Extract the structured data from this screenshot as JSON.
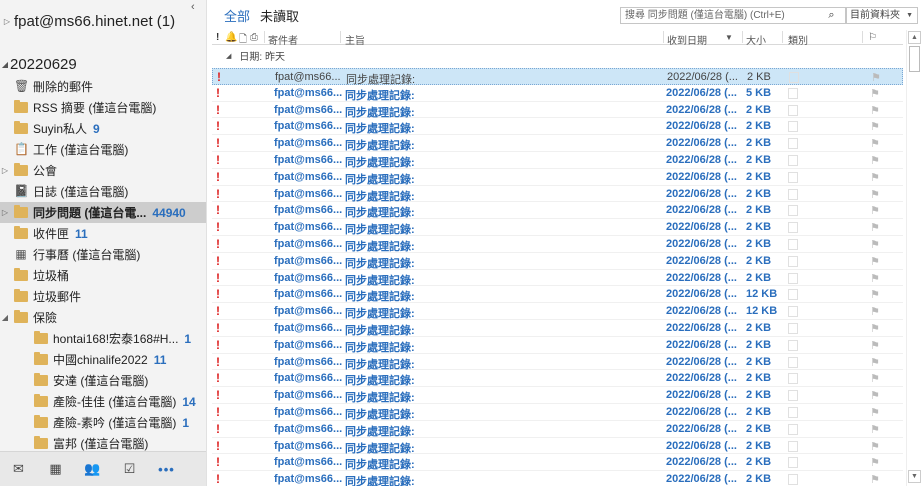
{
  "sidebar": {
    "account": "fpat@ms66.hinet.net (1)",
    "store": "20220629",
    "folders": [
      {
        "name": "刪除的郵件",
        "count": "",
        "icon": "trash-icon",
        "level": 1,
        "arrow": "",
        "selected": false
      },
      {
        "name": "RSS 摘要 (僅這台電腦)",
        "count": "",
        "icon": "folder-icon",
        "level": 1,
        "arrow": "",
        "selected": false
      },
      {
        "name": "Suyin私人",
        "count": "9",
        "icon": "folder-icon",
        "level": 1,
        "arrow": "",
        "selected": false
      },
      {
        "name": "工作 (僅這台電腦)",
        "count": "",
        "icon": "task-icon",
        "level": 1,
        "arrow": "",
        "selected": false
      },
      {
        "name": "公會",
        "count": "",
        "icon": "folder-icon",
        "level": 1,
        "arrow": "▷",
        "selected": false
      },
      {
        "name": "日誌 (僅這台電腦)",
        "count": "",
        "icon": "journal-icon",
        "level": 1,
        "arrow": "",
        "selected": false
      },
      {
        "name": "同步問題 (僅這台電...",
        "count": "44940",
        "icon": "folder-icon",
        "level": 1,
        "arrow": "▷",
        "selected": true
      },
      {
        "name": "收件匣",
        "count": "11",
        "icon": "folder-icon",
        "level": 1,
        "arrow": "",
        "selected": false
      },
      {
        "name": "行事曆 (僅這台電腦)",
        "count": "",
        "icon": "calendar-icon",
        "level": 1,
        "arrow": "",
        "selected": false
      },
      {
        "name": "垃圾桶",
        "count": "",
        "icon": "folder-icon",
        "level": 1,
        "arrow": "",
        "selected": false
      },
      {
        "name": "垃圾郵件",
        "count": "",
        "icon": "folder-icon",
        "level": 1,
        "arrow": "",
        "selected": false
      },
      {
        "name": "保險",
        "count": "",
        "icon": "folder-icon",
        "level": 1,
        "arrow": "◢",
        "selected": false
      },
      {
        "name": "hontai168!宏泰168#H...",
        "count": "1",
        "icon": "folder-icon",
        "level": 2,
        "arrow": "",
        "selected": false
      },
      {
        "name": "中國chinalife2022",
        "count": "11",
        "icon": "folder-icon",
        "level": 2,
        "arrow": "",
        "selected": false
      },
      {
        "name": "安達 (僅這台電腦)",
        "count": "",
        "icon": "folder-icon",
        "level": 2,
        "arrow": "",
        "selected": false
      },
      {
        "name": "產險-佳佳 (僅這台電腦)",
        "count": "14",
        "icon": "folder-icon",
        "level": 2,
        "arrow": "",
        "selected": false
      },
      {
        "name": "產險-素吟 (僅這台電腦)",
        "count": "1",
        "icon": "folder-icon",
        "level": 2,
        "arrow": "",
        "selected": false
      },
      {
        "name": "富邦 (僅這台電腦)",
        "count": "",
        "icon": "folder-icon",
        "level": 2,
        "arrow": "",
        "selected": false
      }
    ],
    "nav": [
      "mail-icon",
      "calendar-icon",
      "people-icon",
      "tasks-icon",
      "more-icon"
    ]
  },
  "toolbar": {
    "filter_all": "全部",
    "filter_unread": "未讀取",
    "search_placeholder": "搜尋 同步問題 (僅這台電腦) (Ctrl+E)",
    "scope": "目前資料夾"
  },
  "columns": {
    "from": "寄件者",
    "subject": "主旨",
    "received": "收到日期",
    "size": "大小",
    "category": "類別"
  },
  "group_label": "日期: 昨天",
  "messages": [
    {
      "from": "fpat@ms66...",
      "subject": "同步處理記錄:",
      "received": "2022/06/28 (...",
      "size": "2 KB",
      "selected": true
    },
    {
      "from": "fpat@ms66...",
      "subject": "同步處理記錄:",
      "received": "2022/06/28 (...",
      "size": "5 KB",
      "selected": false
    },
    {
      "from": "fpat@ms66...",
      "subject": "同步處理記錄:",
      "received": "2022/06/28 (...",
      "size": "2 KB",
      "selected": false
    },
    {
      "from": "fpat@ms66...",
      "subject": "同步處理記錄:",
      "received": "2022/06/28 (...",
      "size": "2 KB",
      "selected": false
    },
    {
      "from": "fpat@ms66...",
      "subject": "同步處理記錄:",
      "received": "2022/06/28 (...",
      "size": "2 KB",
      "selected": false
    },
    {
      "from": "fpat@ms66...",
      "subject": "同步處理記錄:",
      "received": "2022/06/28 (...",
      "size": "2 KB",
      "selected": false
    },
    {
      "from": "fpat@ms66...",
      "subject": "同步處理記錄:",
      "received": "2022/06/28 (...",
      "size": "2 KB",
      "selected": false
    },
    {
      "from": "fpat@ms66...",
      "subject": "同步處理記錄:",
      "received": "2022/06/28 (...",
      "size": "2 KB",
      "selected": false
    },
    {
      "from": "fpat@ms66...",
      "subject": "同步處理記錄:",
      "received": "2022/06/28 (...",
      "size": "2 KB",
      "selected": false
    },
    {
      "from": "fpat@ms66...",
      "subject": "同步處理記錄:",
      "received": "2022/06/28 (...",
      "size": "2 KB",
      "selected": false
    },
    {
      "from": "fpat@ms66...",
      "subject": "同步處理記錄:",
      "received": "2022/06/28 (...",
      "size": "2 KB",
      "selected": false
    },
    {
      "from": "fpat@ms66...",
      "subject": "同步處理記錄:",
      "received": "2022/06/28 (...",
      "size": "2 KB",
      "selected": false
    },
    {
      "from": "fpat@ms66...",
      "subject": "同步處理記錄:",
      "received": "2022/06/28 (...",
      "size": "2 KB",
      "selected": false
    },
    {
      "from": "fpat@ms66...",
      "subject": "同步處理記錄:",
      "received": "2022/06/28 (...",
      "size": "12 KB",
      "selected": false
    },
    {
      "from": "fpat@ms66...",
      "subject": "同步處理記錄:",
      "received": "2022/06/28 (...",
      "size": "12 KB",
      "selected": false
    },
    {
      "from": "fpat@ms66...",
      "subject": "同步處理記錄:",
      "received": "2022/06/28 (...",
      "size": "2 KB",
      "selected": false
    },
    {
      "from": "fpat@ms66...",
      "subject": "同步處理記錄:",
      "received": "2022/06/28 (...",
      "size": "2 KB",
      "selected": false
    },
    {
      "from": "fpat@ms66...",
      "subject": "同步處理記錄:",
      "received": "2022/06/28 (...",
      "size": "2 KB",
      "selected": false
    },
    {
      "from": "fpat@ms66...",
      "subject": "同步處理記錄:",
      "received": "2022/06/28 (...",
      "size": "2 KB",
      "selected": false
    },
    {
      "from": "fpat@ms66...",
      "subject": "同步處理記錄:",
      "received": "2022/06/28 (...",
      "size": "2 KB",
      "selected": false
    },
    {
      "from": "fpat@ms66...",
      "subject": "同步處理記錄:",
      "received": "2022/06/28 (...",
      "size": "2 KB",
      "selected": false
    },
    {
      "from": "fpat@ms66...",
      "subject": "同步處理記錄:",
      "received": "2022/06/28 (...",
      "size": "2 KB",
      "selected": false
    },
    {
      "from": "fpat@ms66...",
      "subject": "同步處理記錄:",
      "received": "2022/06/28 (...",
      "size": "2 KB",
      "selected": false
    },
    {
      "from": "fpat@ms66...",
      "subject": "同步處理記錄:",
      "received": "2022/06/28 (...",
      "size": "2 KB",
      "selected": false
    },
    {
      "from": "fpat@ms66...",
      "subject": "同步處理記錄:",
      "received": "2022/06/28 (...",
      "size": "2 KB",
      "selected": false
    }
  ]
}
